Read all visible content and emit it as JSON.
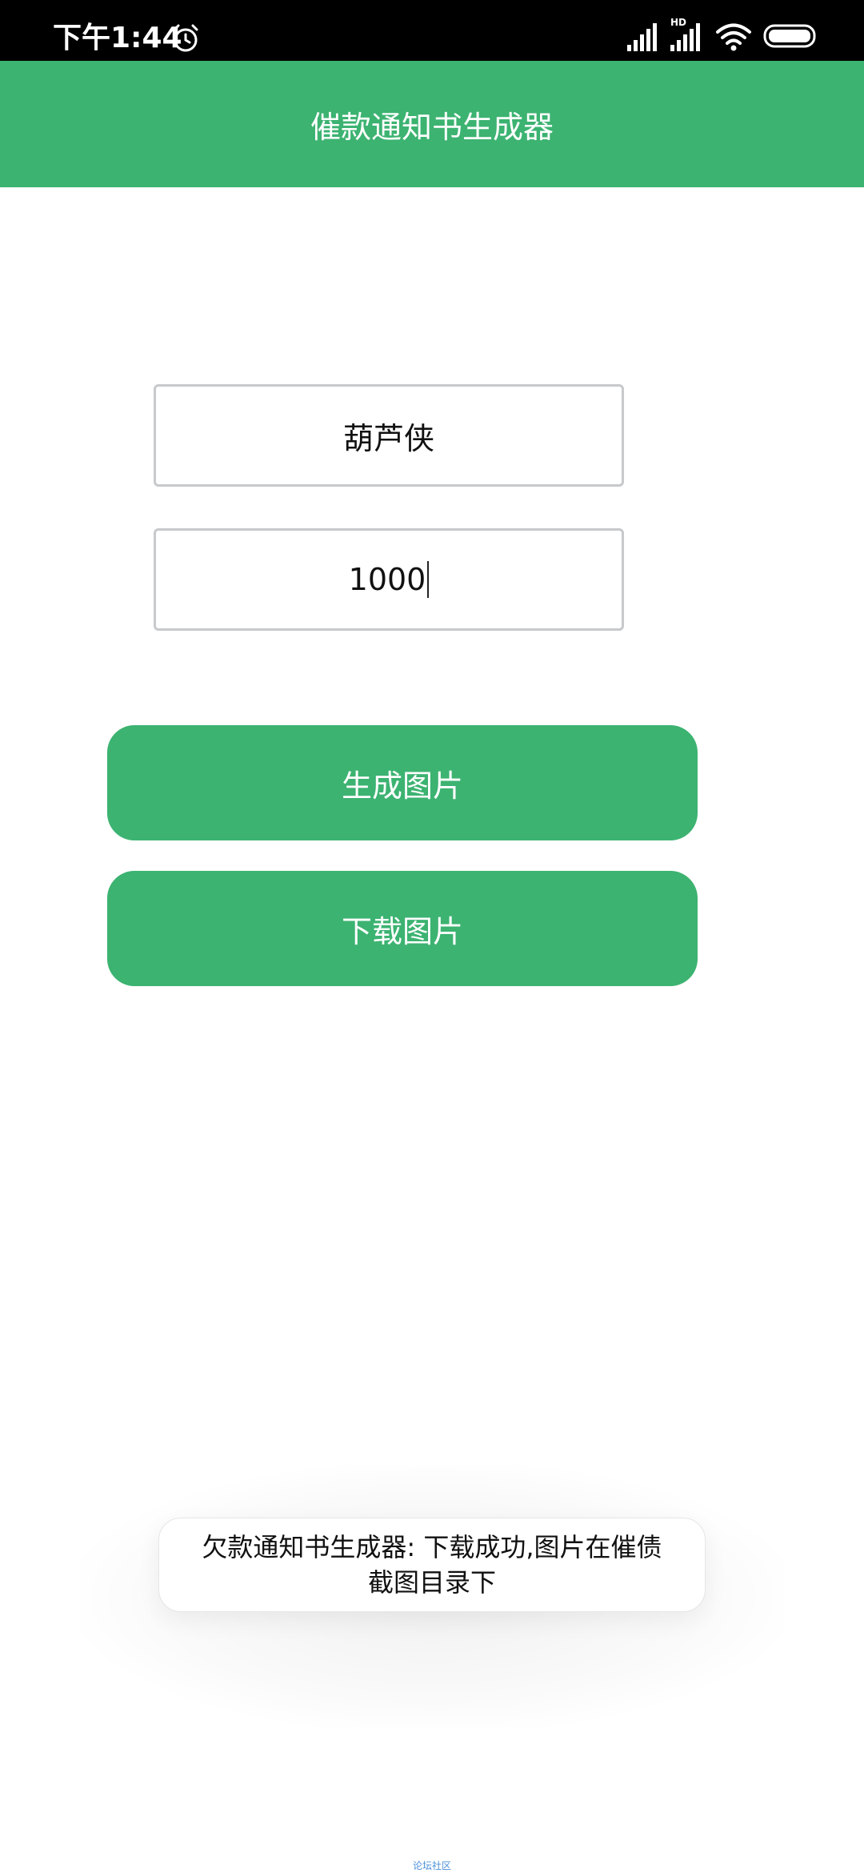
{
  "status_bar": {
    "time": "下午1:44",
    "icons": [
      "alarm-icon",
      "signal-icon",
      "hd-signal-icon",
      "wifi-icon",
      "battery-icon"
    ]
  },
  "app_bar": {
    "title": "催款通知书生成器"
  },
  "form": {
    "name_value": "葫芦侠",
    "amount_value": "1000"
  },
  "buttons": {
    "generate_label": "生成图片",
    "download_label": "下载图片"
  },
  "toast": {
    "message": "欠款通知书生成器: 下载成功,图片在催债截图目录下"
  },
  "watermark": {
    "text": "论坛社区"
  },
  "colors": {
    "accent": "#3cb371",
    "status_bar": "#000000",
    "background": "#ffffff"
  }
}
